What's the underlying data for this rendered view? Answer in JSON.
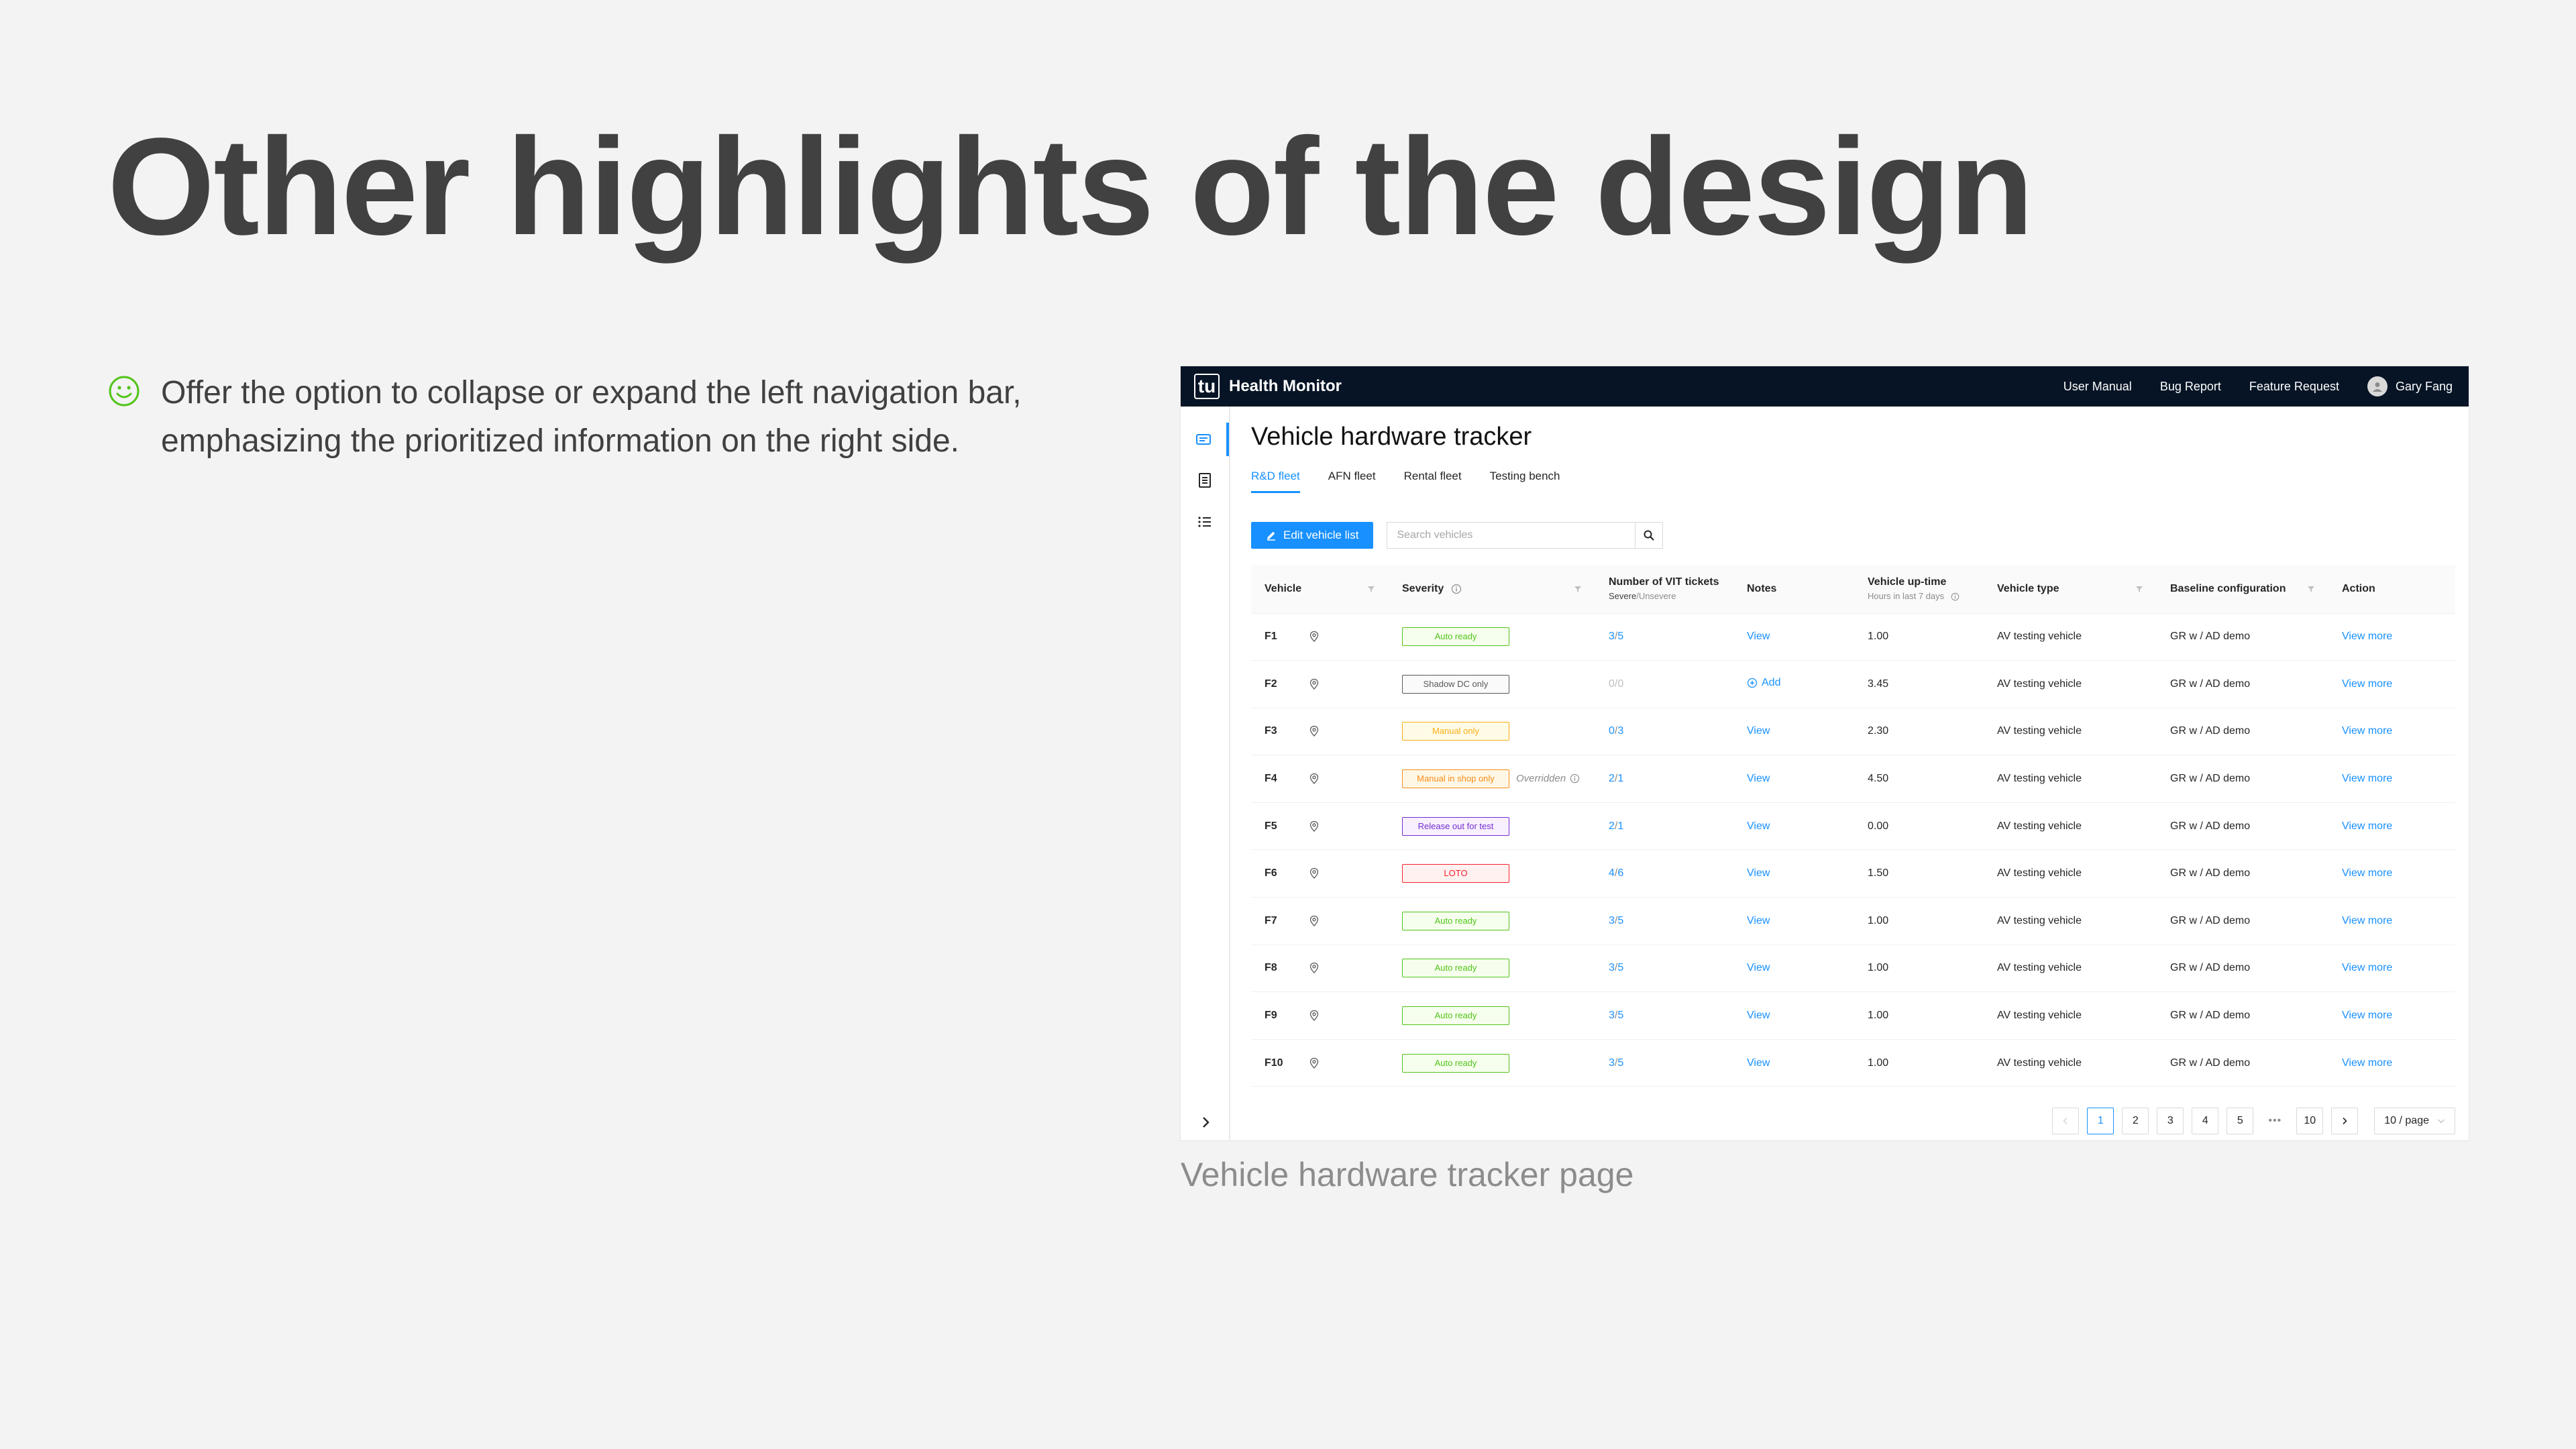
{
  "slide": {
    "title": "Other highlights of the design",
    "bullet": "Offer the option to collapse or expand the left navigation bar, emphasizing the prioritized information on the right side.",
    "caption": "Vehicle hardware tracker page",
    "bullet_icon": "smiley-icon",
    "accent_color": "#52c41a"
  },
  "app": {
    "logo": "tu",
    "name": "Health Monitor",
    "nav": [
      "User Manual",
      "Bug Report",
      "Feature Request"
    ],
    "user": "Gary Fang",
    "sidebar_icons": [
      "dashboard-icon",
      "document-icon",
      "list-icon"
    ],
    "brand_color": "#1890ff",
    "topbar_color": "#061425"
  },
  "page": {
    "title": "Vehicle hardware tracker",
    "tabs": [
      "R&D fleet",
      "AFN fleet",
      "Rental fleet",
      "Testing bench"
    ],
    "active_tab": "R&D fleet",
    "edit_button": "Edit vehicle list",
    "search_placeholder": "Search vehicles"
  },
  "table": {
    "headers": {
      "vehicle": "Vehicle",
      "severity": "Severity",
      "tickets": "Number of VIT tickets",
      "tickets_sub_severe": "Severe",
      "tickets_sub_unsevere": "/Unsevere",
      "notes": "Notes",
      "uptime": "Vehicle up-time",
      "uptime_sub": "Hours in last 7 days",
      "type": "Vehicle type",
      "baseline": "Baseline configuration",
      "action": "Action"
    },
    "rows": [
      {
        "vehicle": "F1",
        "severity": "Auto ready",
        "severity_color": "#52c41a",
        "severity_bg": "#f6ffed",
        "overridden": "",
        "severe": "3",
        "unsevere": "5",
        "muted": false,
        "notes": "View",
        "uptime": "1.00",
        "type": "AV testing vehicle",
        "baseline": "GR w / AD demo",
        "action": "View more"
      },
      {
        "vehicle": "F2",
        "severity": "Shadow DC only",
        "severity_color": "#595959",
        "severity_bg": "#fafafa",
        "overridden": "",
        "severe": "0",
        "unsevere": "0",
        "muted": true,
        "notes": "Add",
        "uptime": "3.45",
        "type": "AV testing vehicle",
        "baseline": "GR w / AD demo",
        "action": "View more"
      },
      {
        "vehicle": "F3",
        "severity": "Manual only",
        "severity_color": "#faad14",
        "severity_bg": "#fffbe6",
        "overridden": "",
        "severe": "0",
        "unsevere": "3",
        "muted": false,
        "notes": "View",
        "uptime": "2.30",
        "type": "AV testing vehicle",
        "baseline": "GR w / AD demo",
        "action": "View more"
      },
      {
        "vehicle": "F4",
        "severity": "Manual in shop only",
        "severity_color": "#fa8c16",
        "severity_bg": "#fff7e6",
        "overridden": "Overridden",
        "severe": "2",
        "unsevere": "1",
        "muted": false,
        "notes": "View",
        "uptime": "4.50",
        "type": "AV testing vehicle",
        "baseline": "GR w / AD demo",
        "action": "View more"
      },
      {
        "vehicle": "F5",
        "severity": "Release out for test",
        "severity_color": "#722ed1",
        "severity_bg": "#f9f0ff",
        "overridden": "",
        "severe": "2",
        "unsevere": "1",
        "muted": false,
        "notes": "View",
        "uptime": "0.00",
        "type": "AV testing vehicle",
        "baseline": "GR w / AD demo",
        "action": "View more"
      },
      {
        "vehicle": "F6",
        "severity": "LOTO",
        "severity_color": "#f5222d",
        "severity_bg": "#fff1f0",
        "overridden": "",
        "severe": "4",
        "unsevere": "6",
        "muted": false,
        "notes": "View",
        "uptime": "1.50",
        "type": "AV testing vehicle",
        "baseline": "GR w / AD demo",
        "action": "View more"
      },
      {
        "vehicle": "F7",
        "severity": "Auto ready",
        "severity_color": "#52c41a",
        "severity_bg": "#f6ffed",
        "overridden": "",
        "severe": "3",
        "unsevere": "5",
        "muted": false,
        "notes": "View",
        "uptime": "1.00",
        "type": "AV testing vehicle",
        "baseline": "GR w / AD demo",
        "action": "View more"
      },
      {
        "vehicle": "F8",
        "severity": "Auto ready",
        "severity_color": "#52c41a",
        "severity_bg": "#f6ffed",
        "overridden": "",
        "severe": "3",
        "unsevere": "5",
        "muted": false,
        "notes": "View",
        "uptime": "1.00",
        "type": "AV testing vehicle",
        "baseline": "GR w / AD demo",
        "action": "View more"
      },
      {
        "vehicle": "F9",
        "severity": "Auto ready",
        "severity_color": "#52c41a",
        "severity_bg": "#f6ffed",
        "overridden": "",
        "severe": "3",
        "unsevere": "5",
        "muted": false,
        "notes": "View",
        "uptime": "1.00",
        "type": "AV testing vehicle",
        "baseline": "GR w / AD demo",
        "action": "View more"
      },
      {
        "vehicle": "F10",
        "severity": "Auto ready",
        "severity_color": "#52c41a",
        "severity_bg": "#f6ffed",
        "overridden": "",
        "severe": "3",
        "unsevere": "5",
        "muted": false,
        "notes": "View",
        "uptime": "1.00",
        "type": "AV testing vehicle",
        "baseline": "GR w / AD demo",
        "action": "View more"
      }
    ]
  },
  "pagination": {
    "pages": [
      "1",
      "2",
      "3",
      "4",
      "5"
    ],
    "current": "1",
    "ellipsis": "•••",
    "last": "10",
    "page_size": "10 / page"
  }
}
